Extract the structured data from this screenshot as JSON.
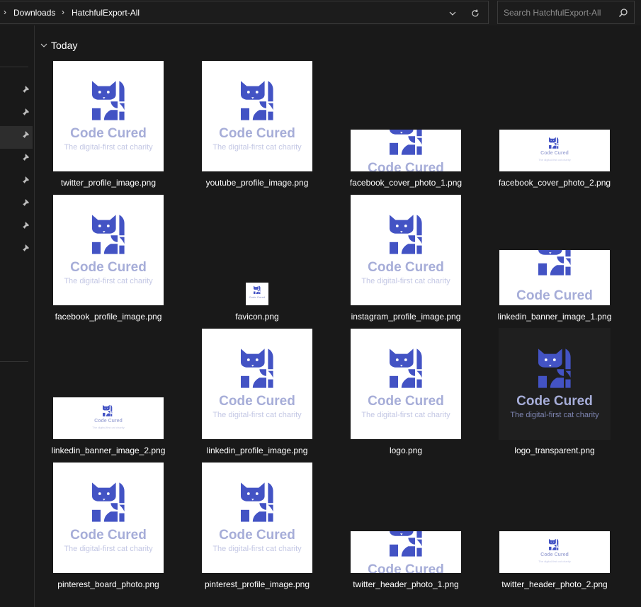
{
  "breadcrumb": {
    "items": [
      "Downloads",
      "HatchfulExport-All"
    ]
  },
  "search": {
    "placeholder": "Search HatchfulExport-All"
  },
  "group": {
    "label": "Today"
  },
  "brand": {
    "name": "Code Cured",
    "tagline": "The digital-first cat charity"
  },
  "colors": {
    "accent": "#4353c4",
    "accent_light": "#a6add8",
    "background": "#191919"
  },
  "files": [
    {
      "name": "twitter_profile_image.png",
      "kind": "square"
    },
    {
      "name": "youtube_profile_image.png",
      "kind": "square"
    },
    {
      "name": "facebook_cover_photo_1.png",
      "kind": "banner-crop"
    },
    {
      "name": "facebook_cover_photo_2.png",
      "kind": "banner-small"
    },
    {
      "name": "facebook_profile_image.png",
      "kind": "square"
    },
    {
      "name": "favicon.png",
      "kind": "icon"
    },
    {
      "name": "instagram_profile_image.png",
      "kind": "square"
    },
    {
      "name": "linkedin_banner_image_1.png",
      "kind": "banner-medium"
    },
    {
      "name": "linkedin_banner_image_2.png",
      "kind": "banner-small"
    },
    {
      "name": "linkedin_profile_image.png",
      "kind": "square"
    },
    {
      "name": "logo.png",
      "kind": "square"
    },
    {
      "name": "logo_transparent.png",
      "kind": "square-dark"
    },
    {
      "name": "pinterest_board_photo.png",
      "kind": "square"
    },
    {
      "name": "pinterest_profile_image.png",
      "kind": "square"
    },
    {
      "name": "twitter_header_photo_1.png",
      "kind": "banner-crop"
    },
    {
      "name": "twitter_header_photo_2.png",
      "kind": "banner-small"
    }
  ]
}
